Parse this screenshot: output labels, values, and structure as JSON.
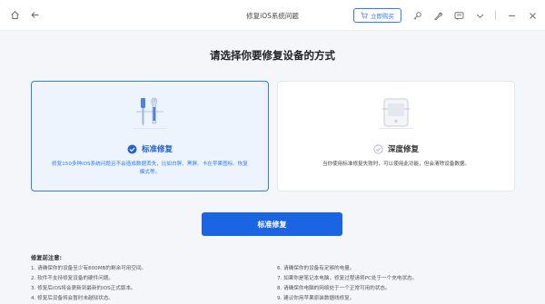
{
  "window": {
    "title": "修复iOS系统问题",
    "buy_label": "立即购买",
    "accent": "#2e7cf6",
    "primary": "#1b64e4"
  },
  "main": {
    "heading": "请选择你要修复设备的方式",
    "modes": [
      {
        "title": "标准修复",
        "description": "修复150多种iOS系统问题且不会造成数据丢失，比如白屏、黑屏、卡在苹果图标、恢复模式等。",
        "selected": true
      },
      {
        "title": "深度修复",
        "description": "当你使用标准修复失败时，可以使用此功能，但会清除设备数据。",
        "selected": false
      }
    ],
    "primary_button": "标准修复"
  },
  "notes": {
    "heading": "修复前注意:",
    "left": [
      "1. 请确保你的设备至少有800MB的剩余可用空间。",
      "2. 软件不支持修复设备的硬件问题。",
      "3. 修复后iOS将会更新到最新的iOS正式版本。",
      "4. 修复后设备将会暂时未越狱状态。"
    ],
    "right": [
      "6. 请确保你的设备有足够的电量。",
      "7. 如果你是笔记本电脑，修复过程请将PC处于一个充电状态。",
      "8. 请确保你电脑的网络处于一个正常可用的状态。",
      "9. 建议你用苹果原装数据线修复。"
    ]
  }
}
